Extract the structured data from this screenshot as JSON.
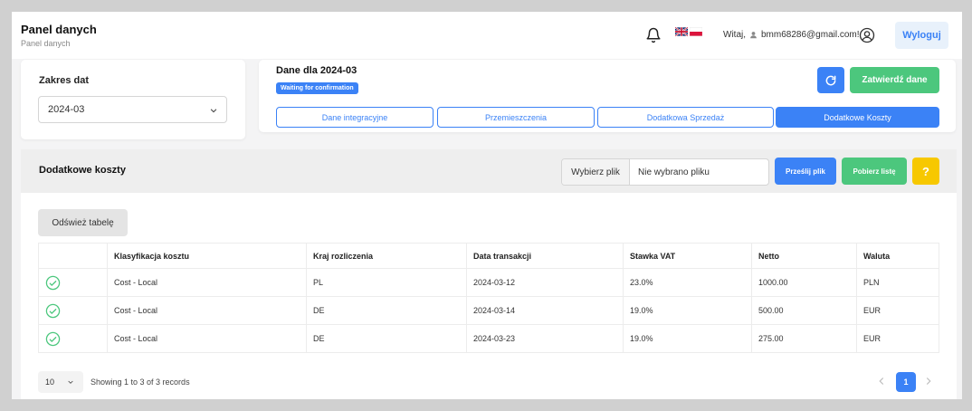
{
  "header": {
    "title": "Panel danych",
    "breadcrumb": "Panel danych",
    "greeting_prefix": "Witaj,",
    "user_email": "bmm68286@gmail.com!",
    "logout_label": "Wyloguj",
    "icons": [
      "bell-icon",
      "flag-uk-icon",
      "flag-pl-icon",
      "user-icon",
      "account-icon"
    ]
  },
  "date_range": {
    "label": "Zakres dat",
    "selected": "2024-03"
  },
  "status": {
    "title": "Dane dla 2024-03",
    "badge": "Waiting for confirmation",
    "confirm_label": "Zatwierdź dane",
    "tabs": [
      {
        "label": "Dane integracyjne",
        "active": false
      },
      {
        "label": "Przemieszczenia",
        "active": false
      },
      {
        "label": "Dodatkowa Sprzedaż",
        "active": false
      },
      {
        "label": "Dodatkowe Koszty",
        "active": true
      }
    ]
  },
  "costs": {
    "title": "Dodatkowe koszty",
    "choose_file_label": "Wybierz plik",
    "no_file_label": "Nie wybrano pliku",
    "upload_label": "Prześlij plik",
    "download_label": "Pobierz listę",
    "help_label": "?",
    "refresh_table_label": "Odśwież tabelę",
    "columns": [
      "",
      "Klasyfikacja kosztu",
      "Kraj rozliczenia",
      "Data transakcji",
      "Stawka VAT",
      "Netto",
      "Waluta"
    ],
    "rows": [
      {
        "classification": "Cost - Local",
        "country": "PL",
        "date": "2024-03-12",
        "vat": "23.0%",
        "net": "1000.00",
        "currency": "PLN"
      },
      {
        "classification": "Cost - Local",
        "country": "DE",
        "date": "2024-03-14",
        "vat": "19.0%",
        "net": "500.00",
        "currency": "EUR"
      },
      {
        "classification": "Cost - Local",
        "country": "DE",
        "date": "2024-03-23",
        "vat": "19.0%",
        "net": "275.00",
        "currency": "EUR"
      }
    ],
    "page_size": "10",
    "records_info": "Showing 1 to 3 of 3 records",
    "current_page": "1"
  },
  "colors": {
    "primary": "#3b82f6",
    "success": "#4cc77d",
    "warning": "#f7c800"
  }
}
